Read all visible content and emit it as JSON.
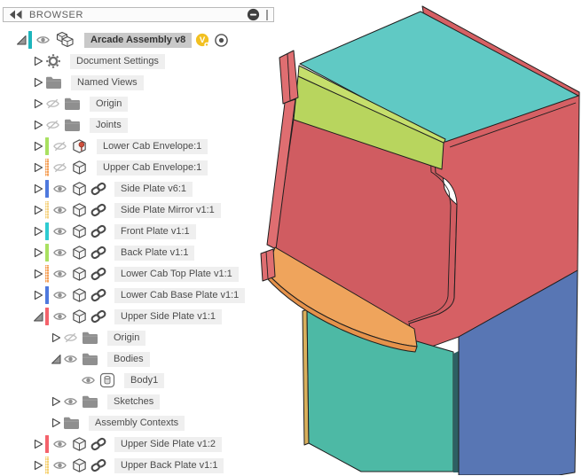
{
  "header": {
    "title": "BROWSER"
  },
  "badges": {
    "version_label": "V"
  },
  "tree": {
    "items": [
      {
        "label": "Arcade Assembly v8",
        "level": 0,
        "expand": "expanded",
        "bar": {
          "color": "#1db5bc",
          "dotted": false
        },
        "eye": "visible",
        "icon": "assembly",
        "link": false,
        "selected": true,
        "badges": [
          "version",
          "active"
        ]
      },
      {
        "label": "Document Settings",
        "level": 1,
        "expand": "collapsed",
        "bar": null,
        "eye": null,
        "icon": "gear",
        "link": false,
        "selected": false,
        "badges": []
      },
      {
        "label": "Named Views",
        "level": 1,
        "expand": "collapsed",
        "bar": null,
        "eye": null,
        "icon": "folder",
        "link": false,
        "selected": false,
        "badges": []
      },
      {
        "label": "Origin",
        "level": 1,
        "expand": "collapsed",
        "bar": null,
        "eye": "hidden",
        "icon": "folder",
        "link": false,
        "selected": false,
        "badges": []
      },
      {
        "label": "Joints",
        "level": 1,
        "expand": "collapsed",
        "bar": null,
        "eye": "hidden",
        "icon": "folder",
        "link": false,
        "selected": false,
        "badges": []
      },
      {
        "label": "Lower Cab Envelope:1",
        "level": 1,
        "expand": "collapsed",
        "bar": {
          "color": "#a9e161",
          "dotted": false
        },
        "eye": "hidden",
        "icon": "component-pinned",
        "link": false,
        "selected": false,
        "badges": []
      },
      {
        "label": "Upper Cab Envelope:1",
        "level": 1,
        "expand": "collapsed",
        "bar": {
          "color": "#f59d52",
          "dotted": true
        },
        "eye": "hidden",
        "icon": "component",
        "link": false,
        "selected": false,
        "badges": []
      },
      {
        "label": "Side Plate v6:1",
        "level": 1,
        "expand": "collapsed",
        "bar": {
          "color": "#4e79de",
          "dotted": false
        },
        "eye": "visible",
        "icon": "component",
        "link": true,
        "selected": false,
        "badges": []
      },
      {
        "label": "Side Plate Mirror v1:1",
        "level": 1,
        "expand": "collapsed",
        "bar": {
          "color": "#f6d27f",
          "dotted": true
        },
        "eye": "visible",
        "icon": "component",
        "link": true,
        "selected": false,
        "badges": []
      },
      {
        "label": "Front Plate v1:1",
        "level": 1,
        "expand": "collapsed",
        "bar": {
          "color": "#2ecbd1",
          "dotted": false
        },
        "eye": "visible",
        "icon": "component",
        "link": true,
        "selected": false,
        "badges": []
      },
      {
        "label": "Back Plate v1:1",
        "level": 1,
        "expand": "collapsed",
        "bar": {
          "color": "#a9e161",
          "dotted": false
        },
        "eye": "visible",
        "icon": "component",
        "link": true,
        "selected": false,
        "badges": []
      },
      {
        "label": "Lower Cab Top Plate v1:1",
        "level": 1,
        "expand": "collapsed",
        "bar": {
          "color": "#f59d52",
          "dotted": true
        },
        "eye": "visible",
        "icon": "component",
        "link": true,
        "selected": false,
        "badges": []
      },
      {
        "label": "Lower Cab Base Plate v1:1",
        "level": 1,
        "expand": "collapsed",
        "bar": {
          "color": "#4e79de",
          "dotted": false
        },
        "eye": "visible",
        "icon": "component",
        "link": true,
        "selected": false,
        "badges": []
      },
      {
        "label": "Upper Side Plate v1:1",
        "level": 1,
        "expand": "expanded",
        "bar": {
          "color": "#f4626b",
          "dotted": false
        },
        "eye": "visible",
        "icon": "component",
        "link": true,
        "selected": false,
        "badges": []
      },
      {
        "label": "Origin",
        "level": 2,
        "expand": "collapsed",
        "bar": null,
        "eye": "hidden",
        "icon": "folder",
        "link": false,
        "selected": false,
        "badges": []
      },
      {
        "label": "Bodies",
        "level": 2,
        "expand": "expanded",
        "bar": null,
        "eye": "visible",
        "icon": "folder",
        "link": false,
        "selected": false,
        "badges": []
      },
      {
        "label": "Body1",
        "level": 3,
        "expand": "none",
        "bar": null,
        "eye": "visible",
        "icon": "body",
        "link": false,
        "selected": false,
        "badges": []
      },
      {
        "label": "Sketches",
        "level": 2,
        "expand": "collapsed",
        "bar": null,
        "eye": "visible",
        "icon": "folder",
        "link": false,
        "selected": false,
        "badges": []
      },
      {
        "label": "Assembly Contexts",
        "level": 2,
        "expand": "collapsed",
        "bar": null,
        "eye": null,
        "icon": "folder",
        "link": false,
        "selected": false,
        "badges": []
      },
      {
        "label": "Upper Side Plate v1:2",
        "level": 1,
        "expand": "collapsed",
        "bar": {
          "color": "#f4626b",
          "dotted": false
        },
        "eye": "visible",
        "icon": "component",
        "link": true,
        "selected": false,
        "badges": []
      },
      {
        "label": "Upper Back Plate v1:1",
        "level": 1,
        "expand": "collapsed",
        "bar": {
          "color": "#f6d06e",
          "dotted": true
        },
        "eye": "visible",
        "icon": "component",
        "link": true,
        "selected": false,
        "badges": []
      }
    ]
  },
  "viewport": {
    "colors": {
      "red_face": "#d66064",
      "red_interior": "#d05c61",
      "red_edge": "#df6e71",
      "teal_top": "#60c9c4",
      "lime_edge": "#c6df6c",
      "lime_face": "#b8d55e",
      "orange_face": "#efa45c",
      "orange_edge": "#e5924b",
      "teal_front": "#4db9a5",
      "blue_face": "#5876b4",
      "tan_edge": "#d9af5c",
      "shadow_gap": "#2d5f63"
    }
  }
}
